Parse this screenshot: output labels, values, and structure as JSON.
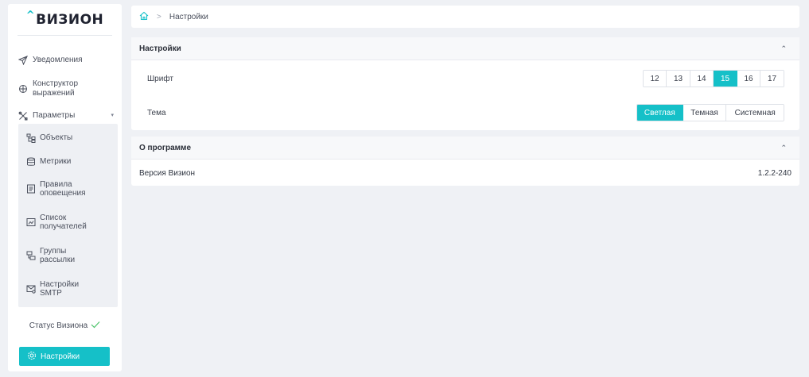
{
  "brand": {
    "caret": "^",
    "name": "ВИЗИОН"
  },
  "sidebar": {
    "items": [
      {
        "label": "Уведомления",
        "icon": "send-icon"
      },
      {
        "label": "Конструктор выражений",
        "icon": "move-icon"
      },
      {
        "label": "Параметры",
        "icon": "tools-icon",
        "expanded": true
      }
    ],
    "sub_items": [
      {
        "label": "Объекты",
        "icon": "hierarchy-icon"
      },
      {
        "label": "Метрики",
        "icon": "database-icon"
      },
      {
        "label": "Правила оповещения",
        "icon": "rules-icon"
      },
      {
        "label": "Список получателей",
        "icon": "recipients-icon"
      },
      {
        "label": "Группы рассылки",
        "icon": "groups-icon"
      },
      {
        "label": "Настройки SMTP",
        "icon": "mail-settings-icon"
      }
    ],
    "status_label": "Статус Визиона",
    "active_item": {
      "label": "Настройки",
      "icon": "gear-icon"
    }
  },
  "breadcrumb": {
    "home_icon": "home-icon",
    "current": "Настройки"
  },
  "settings_panel": {
    "title": "Настройки",
    "font_label": "Шрифт",
    "font_options": [
      "12",
      "13",
      "14",
      "15",
      "16",
      "17"
    ],
    "font_selected": "15",
    "theme_label": "Тема",
    "theme_options": [
      "Светлая",
      "Темная",
      "Системная"
    ],
    "theme_selected": "Светлая"
  },
  "about_panel": {
    "title": "О программе",
    "version_label": "Версия Визион",
    "version_value": "1.2.2-240"
  },
  "colors": {
    "accent": "#15c0c8",
    "background": "#eff1f5"
  }
}
